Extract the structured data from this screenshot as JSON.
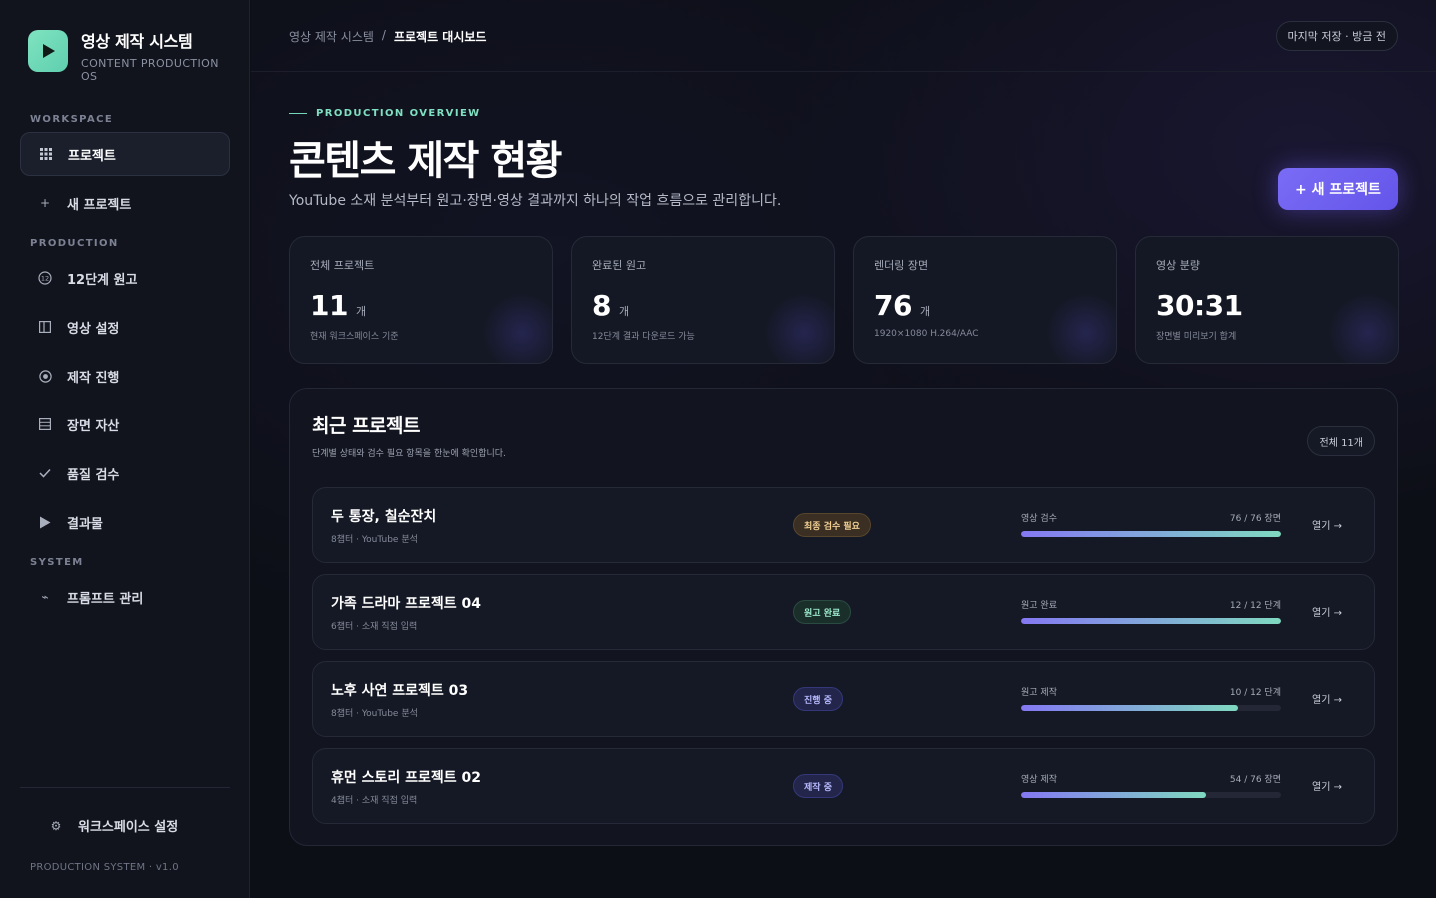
{
  "brand": {
    "title": "영상 제작 시스템",
    "subtitle": "CONTENT PRODUCTION OS",
    "accent": "#6fdcb8"
  },
  "sidebar": {
    "sections": {
      "workspace": "WORKSPACE",
      "production": "PRODUCTION",
      "system": "SYSTEM"
    },
    "items": [
      {
        "label": "프로젝트",
        "icon": "grid-icon",
        "active": true
      },
      {
        "label": "새 프로젝트",
        "icon": "plus-icon",
        "active": false
      },
      {
        "label": "12단계 원고",
        "icon": "circled-twelve-icon",
        "active": false
      },
      {
        "label": "영상 설정",
        "icon": "panel-icon",
        "active": false
      },
      {
        "label": "제작 진행",
        "icon": "target-icon",
        "active": false
      },
      {
        "label": "장면 자산",
        "icon": "list-icon",
        "active": false
      },
      {
        "label": "품질 검수",
        "icon": "check-icon",
        "active": false
      },
      {
        "label": "결과물",
        "icon": "play-icon",
        "active": false
      },
      {
        "label": "프롬프트 관리",
        "icon": "wand-icon",
        "active": false
      }
    ],
    "settings_label": "워크스페이스 설정",
    "version": "PRODUCTION SYSTEM · v1.0"
  },
  "topbar": {
    "breadcrumb_parent": "영상 제작 시스템",
    "breadcrumb_sep": "/",
    "breadcrumb_current": "프로젝트 대시보드",
    "save_status": "마지막 저장 · 방금 전"
  },
  "header": {
    "overline": "PRODUCTION OVERVIEW",
    "title": "콘텐츠 제작 현황",
    "description": "YouTube 소재 분석부터 원고·장면·영상 결과까지 하나의 작업 흐름으로 관리합니다.",
    "new_project_label": "+ 새 프로젝트"
  },
  "stats": [
    {
      "label": "전체 프로젝트",
      "value": "11",
      "unit": "개",
      "note": "현재 워크스페이스 기준"
    },
    {
      "label": "완료된 원고",
      "value": "8",
      "unit": "개",
      "note": "12단계 결과 다운로드 가능"
    },
    {
      "label": "렌더링 장면",
      "value": "76",
      "unit": "개",
      "note": "1920×1080 H.264/AAC"
    },
    {
      "label": "영상 분량",
      "value": "30:31",
      "unit": "",
      "note": "장면별 미리보기 합계"
    }
  ],
  "recent": {
    "title": "최근 프로젝트",
    "subtitle": "단계별 상태와 검수 필요 항목을 한눈에 확인합니다.",
    "total_label": "전체 11개",
    "open_label": "열기 →",
    "rows": [
      {
        "name": "두 통장, 칠순잔치",
        "meta": "8챕터 · YouTube 분석",
        "badge": "최종 검수 필요",
        "badge_type": "review",
        "progress_label": "영상 검수",
        "progress_count": "76 / 76 장면",
        "progress": 1.0
      },
      {
        "name": "가족 드라마 프로젝트 04",
        "meta": "6챕터 · 소재 직접 입력",
        "badge": "원고 완료",
        "badge_type": "done",
        "progress_label": "원고 완료",
        "progress_count": "12 / 12 단계",
        "progress": 1.0
      },
      {
        "name": "노후 사연 프로젝트 03",
        "meta": "8챕터 · YouTube 분석",
        "badge": "진행 중",
        "badge_type": "progress",
        "progress_label": "원고 제작",
        "progress_count": "10 / 12 단계",
        "progress": 0.833
      },
      {
        "name": "휴먼 스토리 프로젝트 02",
        "meta": "4챕터 · 소재 직접 입력",
        "badge": "제작 중",
        "badge_type": "progress",
        "progress_label": "영상 제작",
        "progress_count": "54 / 76 장면",
        "progress": 0.71
      }
    ]
  }
}
